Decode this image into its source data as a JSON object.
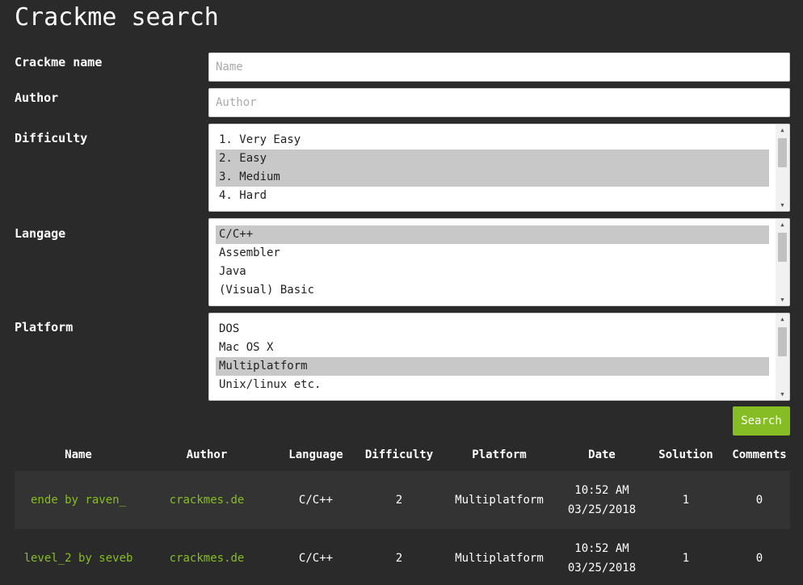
{
  "page": {
    "title": "Crackme search"
  },
  "form": {
    "name": {
      "label": "Crackme name",
      "placeholder": "Name",
      "value": ""
    },
    "author": {
      "label": "Author",
      "placeholder": "Author",
      "value": ""
    },
    "difficulty": {
      "label": "Difficulty",
      "options": [
        {
          "text": "1. Very Easy",
          "selected": false
        },
        {
          "text": "2. Easy",
          "selected": true
        },
        {
          "text": "3. Medium",
          "selected": true
        },
        {
          "text": "4. Hard",
          "selected": false
        }
      ]
    },
    "language": {
      "label": "Langage",
      "options": [
        {
          "text": "C/C++",
          "selected": true
        },
        {
          "text": "Assembler",
          "selected": false
        },
        {
          "text": "Java",
          "selected": false
        },
        {
          "text": "(Visual) Basic",
          "selected": false
        }
      ]
    },
    "platform": {
      "label": "Platform",
      "options": [
        {
          "text": "DOS",
          "selected": false
        },
        {
          "text": "Mac OS X",
          "selected": false
        },
        {
          "text": "Multiplatform",
          "selected": true
        },
        {
          "text": "Unix/linux etc.",
          "selected": false
        }
      ]
    },
    "search_label": "Search"
  },
  "results": {
    "columns": [
      "Name",
      "Author",
      "Language",
      "Difficulty",
      "Platform",
      "Date",
      "Solution",
      "Comments"
    ],
    "rows": [
      {
        "name": "ende by raven_",
        "author": "crackmes.de",
        "language": "C/C++",
        "difficulty": "2",
        "platform": "Multiplatform",
        "time": "10:52 AM",
        "date": "03/25/2018",
        "solutions": "1",
        "comments": "0"
      },
      {
        "name": "level_2 by seveb",
        "author": "crackmes.de",
        "language": "C/C++",
        "difficulty": "2",
        "platform": "Multiplatform",
        "time": "10:52 AM",
        "date": "03/25/2018",
        "solutions": "1",
        "comments": "0"
      }
    ]
  },
  "colors": {
    "background": "#2a2a2a",
    "accent": "#86bd24",
    "row_alt": "#333333",
    "selected_option": "#c8c8c8"
  }
}
